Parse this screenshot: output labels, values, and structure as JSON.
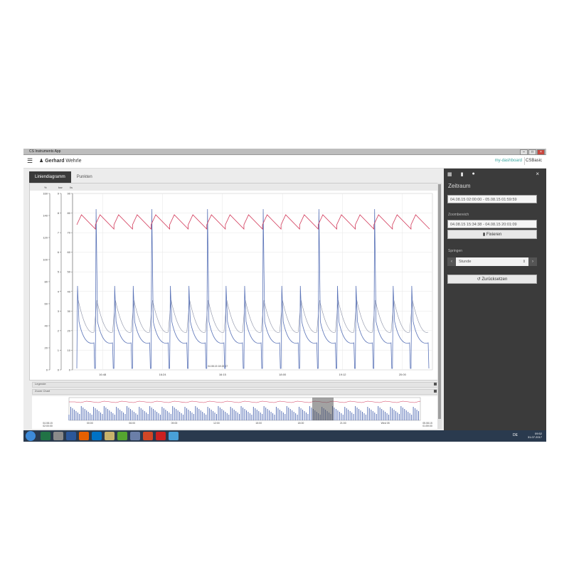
{
  "window": {
    "title": "CS Instruments App"
  },
  "appbar": {
    "user_first": "Gerhard",
    "user_last": "Wehrle",
    "brand": "my-dashboard",
    "brand2": "CSBasic"
  },
  "tabs": [
    {
      "label": "Liniendiagramm",
      "active": true
    },
    {
      "label": "Punkten",
      "active": false
    }
  ],
  "chart_data": {
    "type": "line",
    "axis_headers": [
      "%",
      "bar",
      "l/s"
    ],
    "y_ticks_outer": [
      0,
      20,
      40,
      60,
      80,
      100,
      120,
      140,
      160
    ],
    "y_ticks_middle": [
      0,
      1,
      2,
      3,
      4,
      5,
      6,
      7,
      8,
      9
    ],
    "y_ticks_inner": [
      0,
      10,
      20,
      30,
      40,
      50,
      60,
      70,
      80,
      90
    ],
    "x_ticks": [
      "16:48",
      "16:24",
      "16:15",
      "18:00",
      "19:12",
      "20:00"
    ],
    "cursor_label": "04.08.15 18:15:47",
    "series": [
      {
        "color": "#d23a5a"
      },
      {
        "color": "#5b74b8"
      },
      {
        "color": "#8d93a8"
      }
    ],
    "grid": true
  },
  "legend_bar": {
    "label": "Legende"
  },
  "overview_bar": {
    "label": "Zoom Chart"
  },
  "overview": {
    "x_ticks": [
      "04.08.15\n02:00:00",
      "00:00",
      "06:00",
      "09:00",
      "12:00",
      "15:00",
      "18:00",
      "21:00",
      "Wed 05",
      "05.08.15\n01:59:00"
    ]
  },
  "sidebar": {
    "tab_icons": [
      "calendar-icon",
      "bar-chart-icon",
      "info-icon"
    ],
    "heading": "Zeitraum",
    "zeitraum_value": "04.08.15 02:00:00 - 05.08.15 01:59:59",
    "zoom_label": "Zoombereich",
    "zoom_value": "04.08.15 15:34:38 - 04.08.15 20:01:09",
    "fixieren_label": "Fixieren",
    "springen_label": "Springen",
    "stunde_value": "Stunde",
    "reset_label": "Zurücksetzen"
  },
  "taskbar": {
    "lang": "DE",
    "time": "09:52",
    "date": "31.07.2017"
  },
  "colors": {
    "sidebar_bg": "#3b3b3b",
    "accent": "#3aa6a0",
    "series_red": "#d23a5a",
    "series_blue": "#5b74b8"
  }
}
